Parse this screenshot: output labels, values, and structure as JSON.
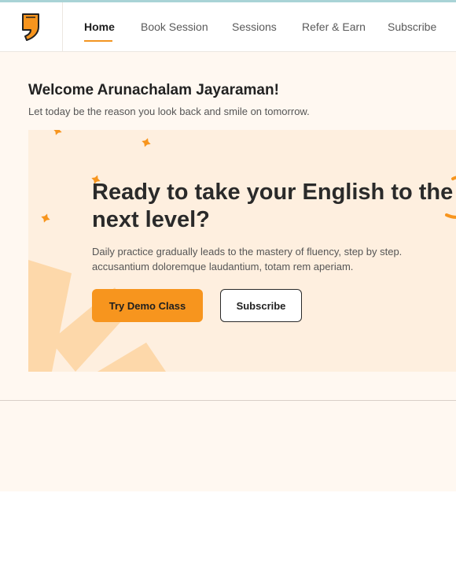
{
  "colors": {
    "accent": "#f7951e",
    "page_background": "#fff8f1",
    "hero_background": "#feefdf",
    "top_line": "#a9d3d6"
  },
  "nav": {
    "logo_icon": "quote-mark-logo-icon",
    "items": [
      {
        "label": "Home",
        "active": true
      },
      {
        "label": "Book Session",
        "active": false
      },
      {
        "label": "Sessions",
        "active": false
      },
      {
        "label": "Refer & Earn",
        "active": false
      },
      {
        "label": "Subscribe",
        "active": false
      }
    ]
  },
  "welcome": {
    "title": "Welcome Arunachalam Jayaraman!",
    "subtitle": "Let today be the reason you look back and smile on tomorrow."
  },
  "hero": {
    "title": "Ready to take your English to the next level?",
    "description": "Daily practice gradually leads to the mastery of fluency, step by step. accusantium doloremque laudantium, totam rem aperiam.",
    "primary_button": "Try Demo Class",
    "secondary_button": "Subscribe",
    "decor_icons": [
      "sparkle-star-icon",
      "sunburst-rays-icon",
      "orange-swoosh-icon"
    ]
  }
}
